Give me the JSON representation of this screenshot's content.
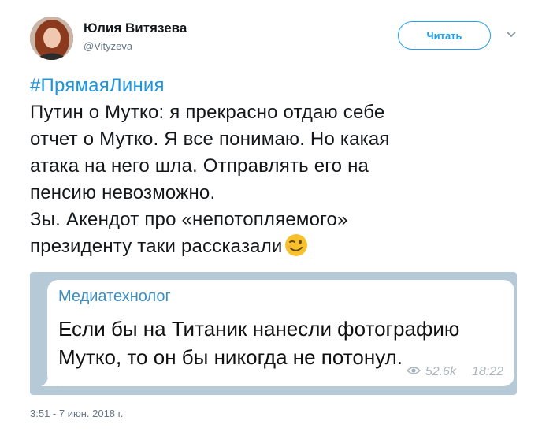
{
  "author": {
    "name": "Юлия Витязева",
    "handle": "@Vityzeva"
  },
  "follow_button": {
    "label": "Читать"
  },
  "tweet": {
    "hashtag": "#ПрямаяЛиния",
    "lines": [
      "Путин о Мутко: я прекрасно отдаю себе",
      "отчет о Мутко. Я все понимаю. Но какая",
      "атака на него шла. Отправлять его на",
      "пенсию невозможно.",
      "Зы. Акендот про «непотопляемого»",
      "президенту таки рассказали"
    ],
    "emoji": "winking-face-emoji"
  },
  "embedded_message": {
    "channel": "Медиатехнолог",
    "text_lines": [
      "Если бы на Титаник нанесли фотографию",
      "Мутко, то он бы никогда не потонул."
    ],
    "views": "52.6k",
    "time": "18:22"
  },
  "timestamp": "3:51 - 7 июн. 2018 г.",
  "colors": {
    "link": "#1b95e0",
    "follow": "#1da1f2",
    "channel": "#3c8ebf",
    "chat_bg": "#b6c9d6"
  }
}
